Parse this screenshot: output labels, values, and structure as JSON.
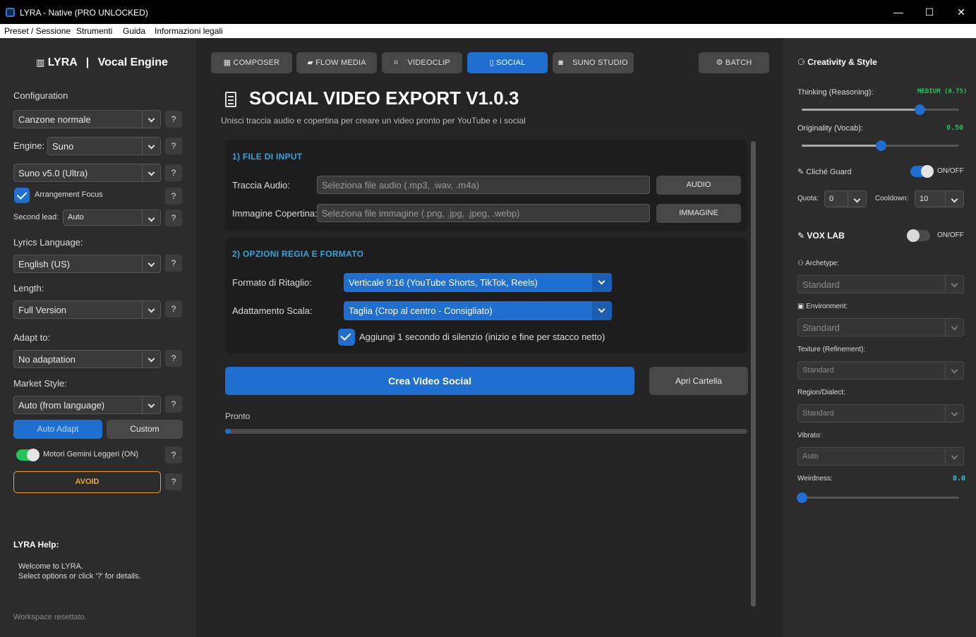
{
  "window": {
    "title": "LYRA - Native (PRO UNLOCKED)",
    "minimize": "—",
    "maximize": "☐",
    "close": "✕"
  },
  "menu": [
    "Preset / Sessione",
    "Strumenti",
    "Guida",
    "Informazioni legali"
  ],
  "sidebar": {
    "brand": "LYRA",
    "separator": "|",
    "engine_title": "Vocal Engine",
    "configuration_label": "Configuration",
    "configuration_value": "Canzone normale",
    "engine_label": "Engine:",
    "engine_value": "Suno",
    "model_value": "Suno v5.0 (Ultra)",
    "arrangement_focus": "Arrangement Focus",
    "second_lead_label": "Second lead:",
    "second_lead_value": "Auto",
    "lyrics_language_label": "Lyrics Language:",
    "lyrics_language_value": "English (US)",
    "length_label": "Length:",
    "length_value": "Full Version",
    "adapt_label": "Adapt to:",
    "adapt_value": "No adaptation",
    "market_label": "Market Style:",
    "market_value": "Auto (from language)",
    "auto_adapt": "Auto Adapt",
    "custom": "Custom",
    "gemini_toggle": "Motori Gemini Leggeri (ON)",
    "avoid": "AVOID",
    "help_q": "?",
    "help_title": "LYRA Help:",
    "help_line1": "Welcome to LYRA.",
    "help_line2": "Select options or click '?' for details.",
    "status": "Workspace resettato."
  },
  "tabs": [
    {
      "icon": "▦",
      "label": "COMPOSER"
    },
    {
      "icon": "▰",
      "label": "FLOW MEDIA"
    },
    {
      "icon": "⌗",
      "label": "VIDEOCLIP"
    },
    {
      "icon": "▯",
      "label": "SOCIAL"
    },
    {
      "icon": "◙",
      "label": "SUNO STUDIO"
    },
    {
      "icon": "⚙",
      "label": "BATCH"
    }
  ],
  "main": {
    "title": "SOCIAL VIDEO EXPORT V1.0.3",
    "subtitle": "Unisci traccia audio e copertina per creare un video pronto per YouTube e i social",
    "input_section": "1) FILE DI INPUT",
    "audio_label": "Traccia Audio:",
    "audio_placeholder": "Seleziona file audio (.mp3, .wav, .m4a)",
    "audio_button": "AUDIO",
    "image_label": "Immagine Copertina:",
    "image_placeholder": "Seleziona file immagine (.png, .jpg, .jpeg, .webp)",
    "image_button": "IMMAGINE",
    "options_section": "2) OPZIONI REGIA E FORMATO",
    "crop_label": "Formato di Ritaglio:",
    "crop_value": "Verticale 9:16 (YouTube Shorts, TikTok, Reels)",
    "scale_label": "Adattamento Scala:",
    "scale_value": "Taglia (Crop al centro - Consigliato)",
    "silence_label": "Aggiungi 1 secondo di silenzio (inizio e fine per stacco netto)",
    "create_button": "Crea Video Social",
    "open_folder": "Apri Cartella",
    "status": "Pronto",
    "progress": 0.01
  },
  "right": {
    "creativity_title": "Creativity & Style",
    "thinking_label": "Thinking (Reasoning):",
    "thinking_value": "MEDIUM (0.75)",
    "thinking": 0.75,
    "originality_label": "Originality (Vocab):",
    "originality_value": "0.50",
    "originality": 0.5,
    "cliche_label": "Cliché Guard",
    "onoff": "ON/OFF",
    "quota_label": "Quota:",
    "quota_value": "0",
    "cooldown_label": "Cooldown:",
    "cooldown_value": "10",
    "vox_title": "VOX LAB",
    "archetype_label": "Archetype:",
    "archetype_value": "Standard",
    "environment_label": "Environment:",
    "environment_value": "Standard",
    "texture_label": "Texture (Refinement):",
    "texture_value": "Standard",
    "region_label": "Region/Dialect:",
    "region_value": "Standard",
    "vibrato_label": "Vibrato:",
    "vibrato_value": "Auto",
    "weirdness_label": "Weirdness:",
    "weirdness_value": "0.0",
    "weirdness": 0.0,
    "colors": {
      "accent": "#1f6fd1",
      "green": "#22c35a",
      "cyan": "#33c3e0"
    }
  }
}
